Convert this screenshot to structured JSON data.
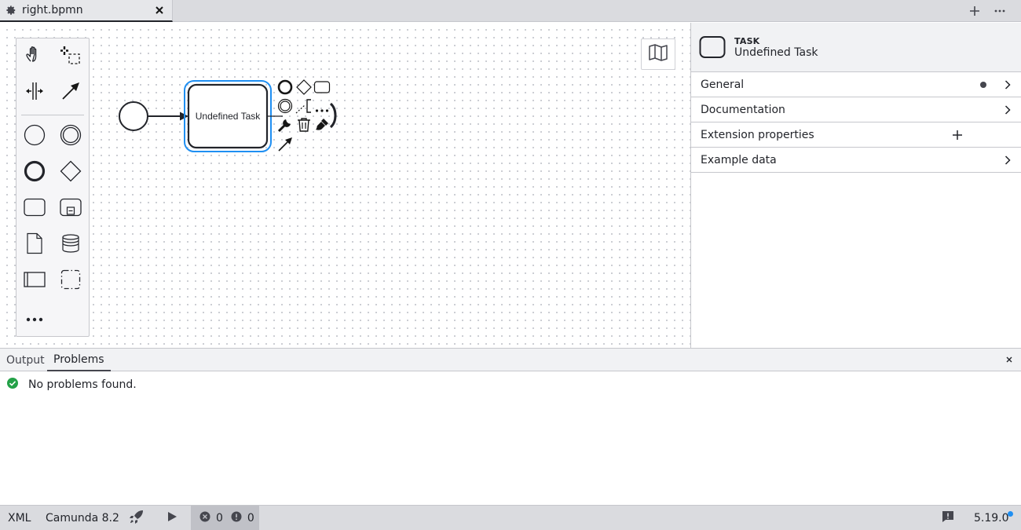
{
  "tabbar": {
    "active_tab": {
      "icon": "gear-icon",
      "title": "right.bpmn",
      "close_icon": "close-icon"
    },
    "add_tab_icon": "plus-icon",
    "more_icon": "ellipsis-icon"
  },
  "palette": {
    "items": [
      {
        "name": "hand-tool",
        "icon": "hand-icon"
      },
      {
        "name": "lasso-tool",
        "icon": "lasso-icon"
      },
      {
        "name": "space-tool",
        "icon": "space-tool-icon"
      },
      {
        "name": "global-connect-tool",
        "icon": "arrow-icon"
      },
      {
        "name": "create-start-event",
        "icon": "start-event-icon"
      },
      {
        "name": "create-intermediate-event",
        "icon": "intermediate-event-icon"
      },
      {
        "name": "create-end-event",
        "icon": "end-event-icon"
      },
      {
        "name": "create-gateway",
        "icon": "gateway-icon"
      },
      {
        "name": "create-task",
        "icon": "task-icon"
      },
      {
        "name": "create-subprocess",
        "icon": "subprocess-icon"
      },
      {
        "name": "create-data-object",
        "icon": "data-object-icon"
      },
      {
        "name": "create-data-store",
        "icon": "data-store-icon"
      },
      {
        "name": "create-pool",
        "icon": "pool-icon"
      },
      {
        "name": "create-group",
        "icon": "group-icon"
      },
      {
        "name": "more-elements",
        "icon": "ellipsis-icon"
      }
    ]
  },
  "diagram": {
    "task_label": "Undefined Task",
    "selection_color": "#1f8ff2"
  },
  "context_pad": {
    "items": [
      {
        "name": "append-end-event",
        "icon": "end-event-icon"
      },
      {
        "name": "append-gateway",
        "icon": "gateway-icon"
      },
      {
        "name": "append-task",
        "icon": "task-icon"
      },
      {
        "name": "append-intermediate-event",
        "icon": "intermediate-event-icon"
      },
      {
        "name": "append-text-annotation",
        "icon": "text-annotation-icon"
      },
      {
        "name": "more-options",
        "icon": "ellipsis-icon"
      },
      {
        "name": "change-type",
        "icon": "wrench-icon"
      },
      {
        "name": "delete",
        "icon": "trash-icon"
      },
      {
        "name": "set-color",
        "icon": "paintbrush-icon"
      },
      {
        "name": "connect",
        "icon": "arrow-icon"
      }
    ]
  },
  "minimap": {
    "icon": "map-icon"
  },
  "properties": {
    "header": {
      "type": "TASK",
      "name": "Undefined Task",
      "icon": "task-icon"
    },
    "groups": [
      {
        "label": "General",
        "has_dot": true,
        "action": "chevron-right-icon"
      },
      {
        "label": "Documentation",
        "has_dot": false,
        "action": "chevron-right-icon"
      },
      {
        "label": "Extension properties",
        "has_dot": false,
        "action": "plus-icon"
      },
      {
        "label": "Example data",
        "has_dot": false,
        "action": "chevron-right-icon"
      }
    ]
  },
  "bottom_panel": {
    "tabs": [
      {
        "label": "Output",
        "active": false
      },
      {
        "label": "Problems",
        "active": true
      }
    ],
    "close_icon": "close-icon",
    "message": "No problems found.",
    "message_icon": "check-circle-icon",
    "success_color": "#24a148"
  },
  "status_bar": {
    "xml": "XML",
    "engine": "Camunda 8.2",
    "deploy_icon": "rocket-icon",
    "run_icon": "play-icon",
    "errors": "0",
    "warnings": "0",
    "feedback_icon": "feedback-icon",
    "version": "5.19.0",
    "update_dot_color": "#1f8ff2"
  }
}
